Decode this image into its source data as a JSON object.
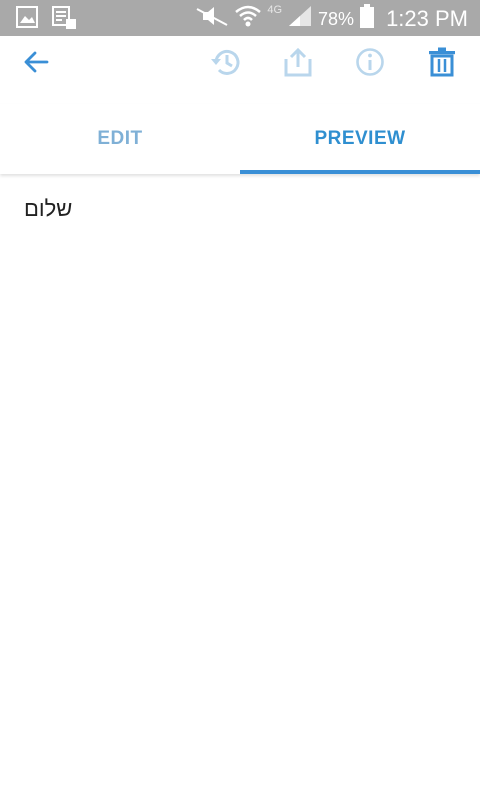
{
  "status_bar": {
    "battery_percent": "78%",
    "time": "1:23 PM",
    "network_label": "4G"
  },
  "toolbar": {
    "icons": [
      "arrow-left-icon",
      "history-icon",
      "share-icon",
      "info-icon",
      "trash-icon"
    ],
    "accent_color": "#3a8fd6",
    "disabled_color": "#b9d6ec"
  },
  "tabs": [
    {
      "label": "EDIT",
      "active": false
    },
    {
      "label": "PREVIEW",
      "active": true
    }
  ],
  "preview": {
    "text": "שלום"
  }
}
